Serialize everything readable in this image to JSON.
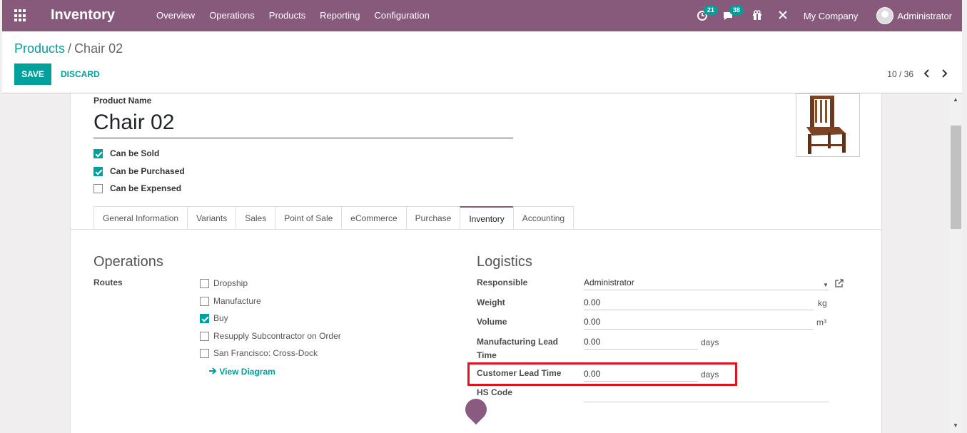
{
  "topbar": {
    "app_name": "Inventory",
    "menu": [
      "Overview",
      "Operations",
      "Products",
      "Reporting",
      "Configuration"
    ],
    "activity_count": "21",
    "messages_count": "38",
    "company": "My Company",
    "user": "Administrator"
  },
  "breadcrumb": {
    "parent": "Products",
    "separator": "/",
    "current": "Chair 02"
  },
  "buttons": {
    "save": "SAVE",
    "discard": "DISCARD"
  },
  "pager": {
    "value": "10 / 36"
  },
  "product": {
    "name_label": "Product Name",
    "name": "Chair 02",
    "checks": [
      {
        "label": "Can be Sold",
        "checked": true
      },
      {
        "label": "Can be Purchased",
        "checked": true
      },
      {
        "label": "Can be Expensed",
        "checked": false
      }
    ]
  },
  "tabs": [
    "General Information",
    "Variants",
    "Sales",
    "Point of Sale",
    "eCommerce",
    "Purchase",
    "Inventory",
    "Accounting"
  ],
  "active_tab": "Inventory",
  "operations": {
    "title": "Operations",
    "routes_label": "Routes",
    "routes": [
      {
        "label": "Dropship",
        "checked": false
      },
      {
        "label": "Manufacture",
        "checked": false
      },
      {
        "label": "Buy",
        "checked": true
      },
      {
        "label": "Resupply Subcontractor on Order",
        "checked": false
      },
      {
        "label": "San Francisco: Cross-Dock",
        "checked": false
      }
    ],
    "view_diagram": "View Diagram"
  },
  "logistics": {
    "title": "Logistics",
    "responsible_label": "Responsible",
    "responsible": "Administrator",
    "weight_label": "Weight",
    "weight": "0.00",
    "weight_unit": "kg",
    "volume_label": "Volume",
    "volume": "0.00",
    "volume_unit": "m³",
    "mfg_lead_label_1": "Manufacturing Lead",
    "mfg_lead_label_2": "Time",
    "mfg_lead": "0.00",
    "mfg_lead_unit": "days",
    "customer_lead_label": "Customer Lead Time",
    "customer_lead": "0.00",
    "customer_lead_unit": "days",
    "hs_code_label": "HS Code",
    "hs_code": ""
  },
  "colors": {
    "brand": "#875a7b",
    "accent": "#00a09d",
    "highlight": "#e0141e"
  }
}
